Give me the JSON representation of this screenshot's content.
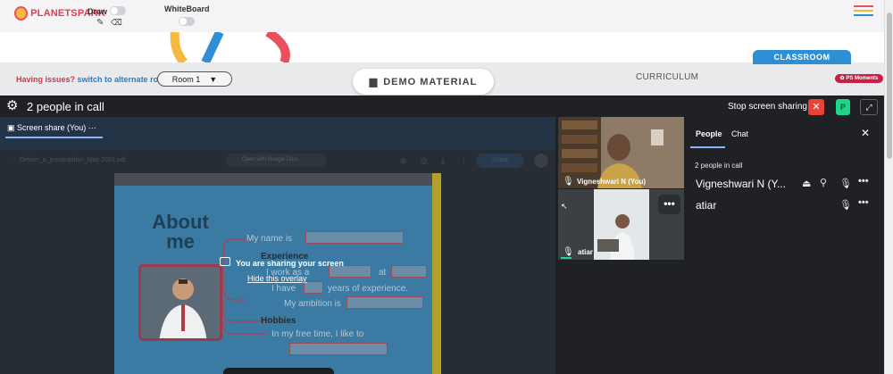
{
  "header": {
    "brand": "PLANETSPARK",
    "draw_label": "Draw",
    "whiteboard_label": "WhiteBoard",
    "menu_icon": "hamburger-icon",
    "menu_colors": [
      "#e94f5c",
      "#f5b93d",
      "#2f8fd4"
    ]
  },
  "toolbar": {
    "issue_text": "Having issues?",
    "switch_link": "switch to alternate room",
    "room_value": "Room 1",
    "demo_material": "DEMO MATERIAL",
    "curriculum": "CURRICULUM",
    "classroom": "CLASSROOM",
    "ps_moments": "PS Moments"
  },
  "meet": {
    "people_in_call": "2 people in call",
    "stop_sharing": "Stop screen sharing",
    "participant_badge": "P",
    "share_tab": "Screen share (You)",
    "doc_name": "Deliver_a_presentation_May 2023.pdf",
    "open_with": "Open with Google Docs",
    "share_btn": "Share",
    "overlay_title": "You are sharing your screen",
    "overlay_hide": "Hide this overlay",
    "slide": {
      "about_line1": "About",
      "about_line2": "me",
      "line_name": "My name is",
      "line_experience": "Experience",
      "line_work": "I work as a",
      "line_at": "at",
      "line_years_a": "I have",
      "line_years_b": "years of experience.",
      "line_ambition": "My ambition is",
      "line_hobbies": "Hobbies",
      "line_free": "In my free time, I like to"
    },
    "tiles": [
      {
        "name": "Vigneshwari N (You)"
      },
      {
        "name": "atiar"
      }
    ]
  },
  "people_panel": {
    "tab_people": "People",
    "tab_chat": "Chat",
    "count_text": "2 people in call",
    "participants": [
      {
        "name": "Vigneshwari N (Y..."
      },
      {
        "name": "atiar"
      }
    ]
  }
}
